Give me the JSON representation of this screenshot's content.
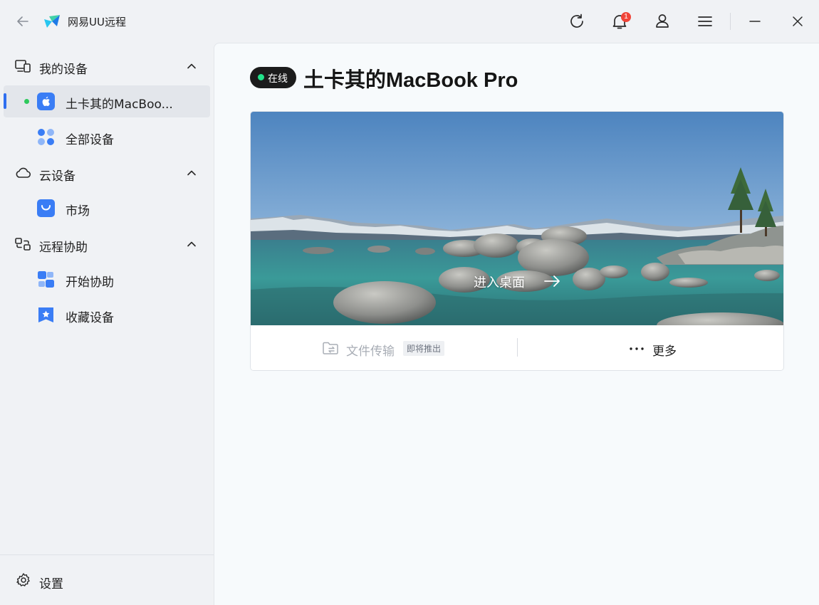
{
  "app": {
    "title": "网易UU远程"
  },
  "titlebar": {
    "notification_count": "1"
  },
  "sidebar": {
    "sections": [
      {
        "label": "我的设备",
        "items": [
          {
            "label": "土卡其的MacBoo...",
            "active": true,
            "online": true
          },
          {
            "label": "全部设备"
          }
        ]
      },
      {
        "label": "云设备",
        "items": [
          {
            "label": "市场"
          }
        ]
      },
      {
        "label": "远程协助",
        "items": [
          {
            "label": "开始协助"
          },
          {
            "label": "收藏设备"
          }
        ]
      }
    ],
    "settings_label": "设置"
  },
  "main": {
    "status": "在线",
    "device_name": "土卡其的MacBook Pro",
    "enter_desktop": "进入桌面",
    "file_transfer": "文件传输",
    "coming_soon": "即将推出",
    "more": "更多"
  },
  "colors": {
    "accent": "#2f6ff0",
    "online": "#22e28a",
    "badge": "#f04438"
  }
}
